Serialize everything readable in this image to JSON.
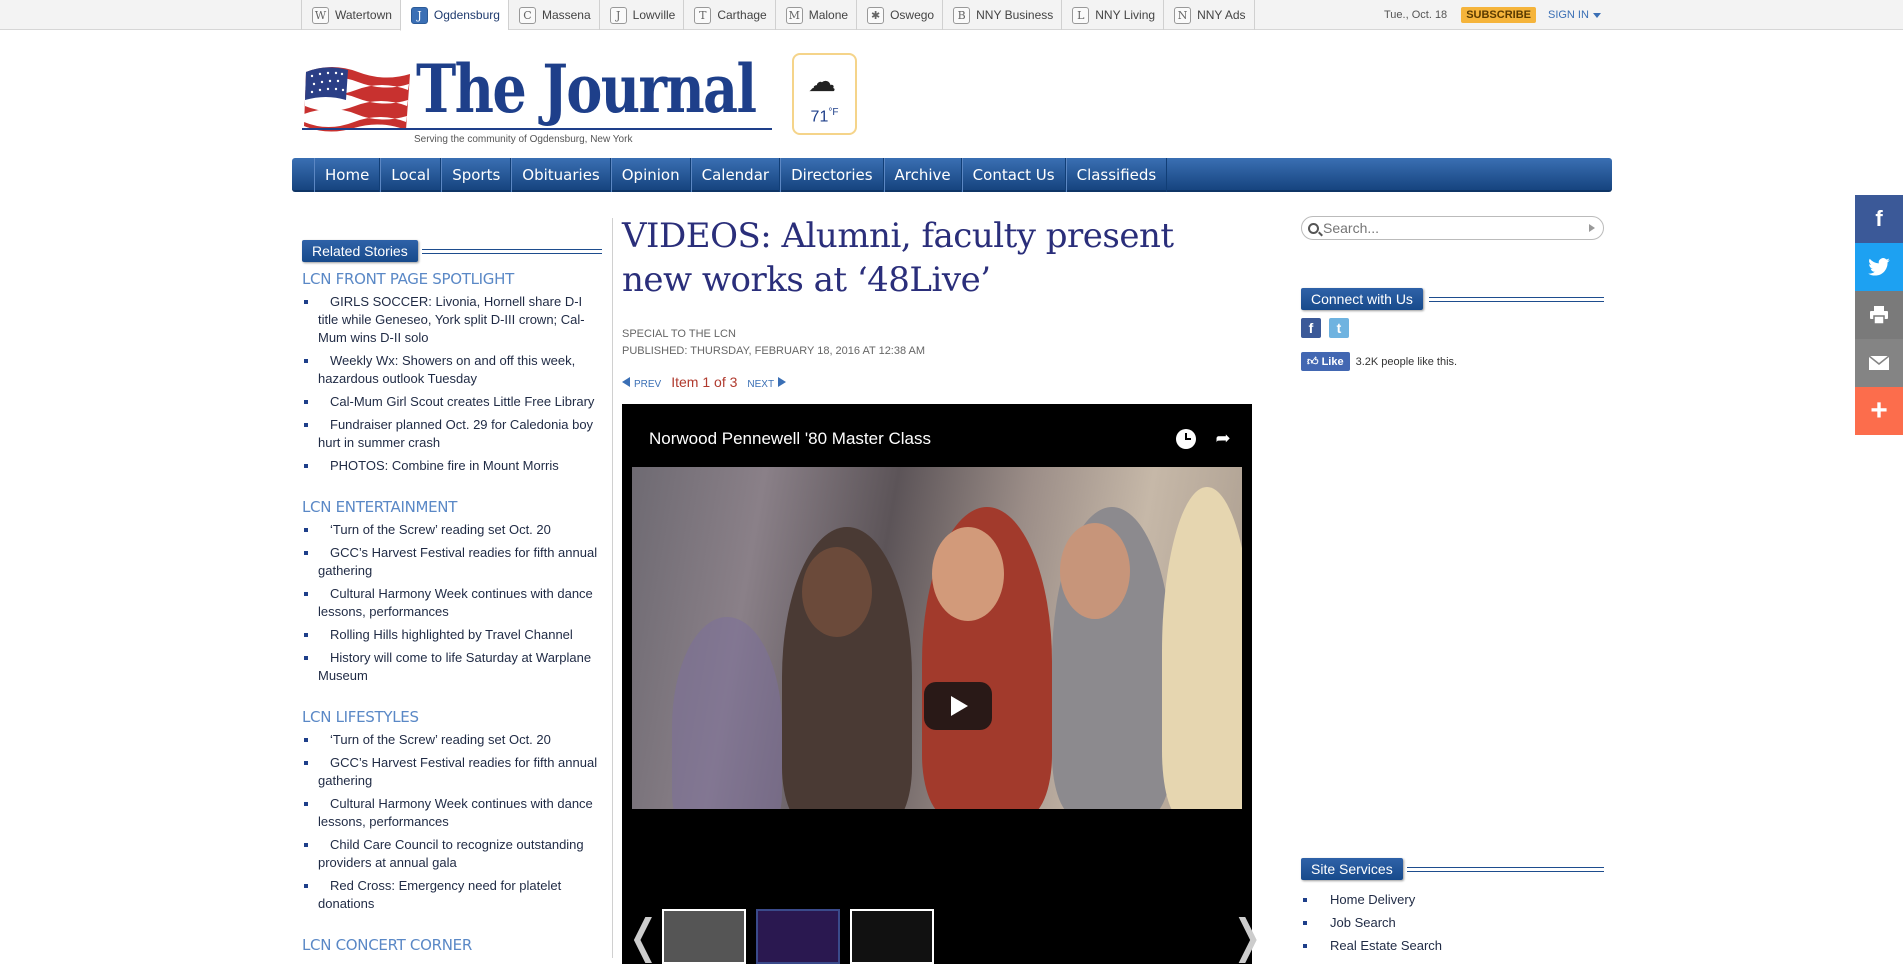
{
  "site_tabs": [
    {
      "label": "Watertown",
      "icon": "W"
    },
    {
      "label": "Ogdensburg",
      "icon": "J"
    },
    {
      "label": "Massena",
      "icon": "C"
    },
    {
      "label": "Lowville",
      "icon": "J"
    },
    {
      "label": "Carthage",
      "icon": "T"
    },
    {
      "label": "Malone",
      "icon": "M"
    },
    {
      "label": "Oswego",
      "icon": "✱"
    },
    {
      "label": "NNY Business",
      "icon": "B"
    },
    {
      "label": "NNY Living",
      "icon": "L"
    },
    {
      "label": "NNY Ads",
      "icon": "N"
    }
  ],
  "top_bar": {
    "date": "Tue., Oct. 18",
    "subscribe": "SUBSCRIBE",
    "sign_in": "SIGN IN"
  },
  "header": {
    "title": "The Journal",
    "tagline": "Serving the community of Ogdensburg, New York"
  },
  "weather": {
    "temp": "71",
    "unit": "°F",
    "icon": "cloud-icon"
  },
  "nav": [
    "Home",
    "Local",
    "Sports",
    "Obituaries",
    "Opinion",
    "Calendar",
    "Directories",
    "Archive",
    "Contact Us",
    "Classifieds"
  ],
  "related": {
    "heading": "Related Stories",
    "sections": [
      {
        "title": "LCN FRONT PAGE SPOTLIGHT",
        "items": [
          "GIRLS SOCCER: Livonia, Hornell share D-I title while Geneseo, York split D-III crown; Cal-Mum wins D-II solo",
          "Weekly Wx: Showers on and off this week, hazardous outlook Tuesday",
          "Cal-Mum Girl Scout creates Little Free Library",
          "Fundraiser planned Oct. 29 for Caledonia boy hurt in summer crash",
          "PHOTOS: Combine fire in Mount Morris"
        ]
      },
      {
        "title": "LCN ENTERTAINMENT",
        "items": [
          "‘Turn of the Screw’ reading set Oct. 20",
          "GCC’s Harvest Festival readies for fifth annual gathering",
          "Cultural Harmony Week continues with dance lessons, performances",
          "Rolling Hills highlighted by Travel Channel",
          "History will come to life Saturday at Warplane Museum"
        ]
      },
      {
        "title": "LCN LIFESTYLES",
        "items": [
          "‘Turn of the Screw’ reading set Oct. 20",
          "GCC’s Harvest Festival readies for fifth annual gathering",
          "Cultural Harmony Week continues with dance lessons, performances",
          "Child Care Council to recognize outstanding providers at annual gala",
          "Red Cross: Emergency need for platelet donations"
        ]
      },
      {
        "title": "LCN CONCERT CORNER",
        "items": []
      }
    ]
  },
  "article": {
    "headline": "VIDEOS: Alumni, faculty present new works at ‘48Live’",
    "byline": "SPECIAL TO THE LCN",
    "published": "PUBLISHED: THURSDAY, FEBRUARY 18, 2016 AT 12:38 AM",
    "pager": {
      "prev": "PREV",
      "count": "Item 1 of 3",
      "next": "NEXT"
    },
    "video_title": "Norwood Pennewell '80 Master Class"
  },
  "sidebar": {
    "search_placeholder": "Search...",
    "connect_heading": "Connect with Us",
    "like_label": "Like",
    "like_count": "3.2K people like this.",
    "services_heading": "Site Services",
    "services": [
      "Home Delivery",
      "Job Search",
      "Real Estate Search"
    ]
  },
  "colors": {
    "brand_blue": "#1e3f8a",
    "nav_blue": "#2a5b9f",
    "subscribe": "#f5b43b",
    "facebook": "#3b5998",
    "twitter": "#1da1f2",
    "add": "#fc6d4c"
  }
}
